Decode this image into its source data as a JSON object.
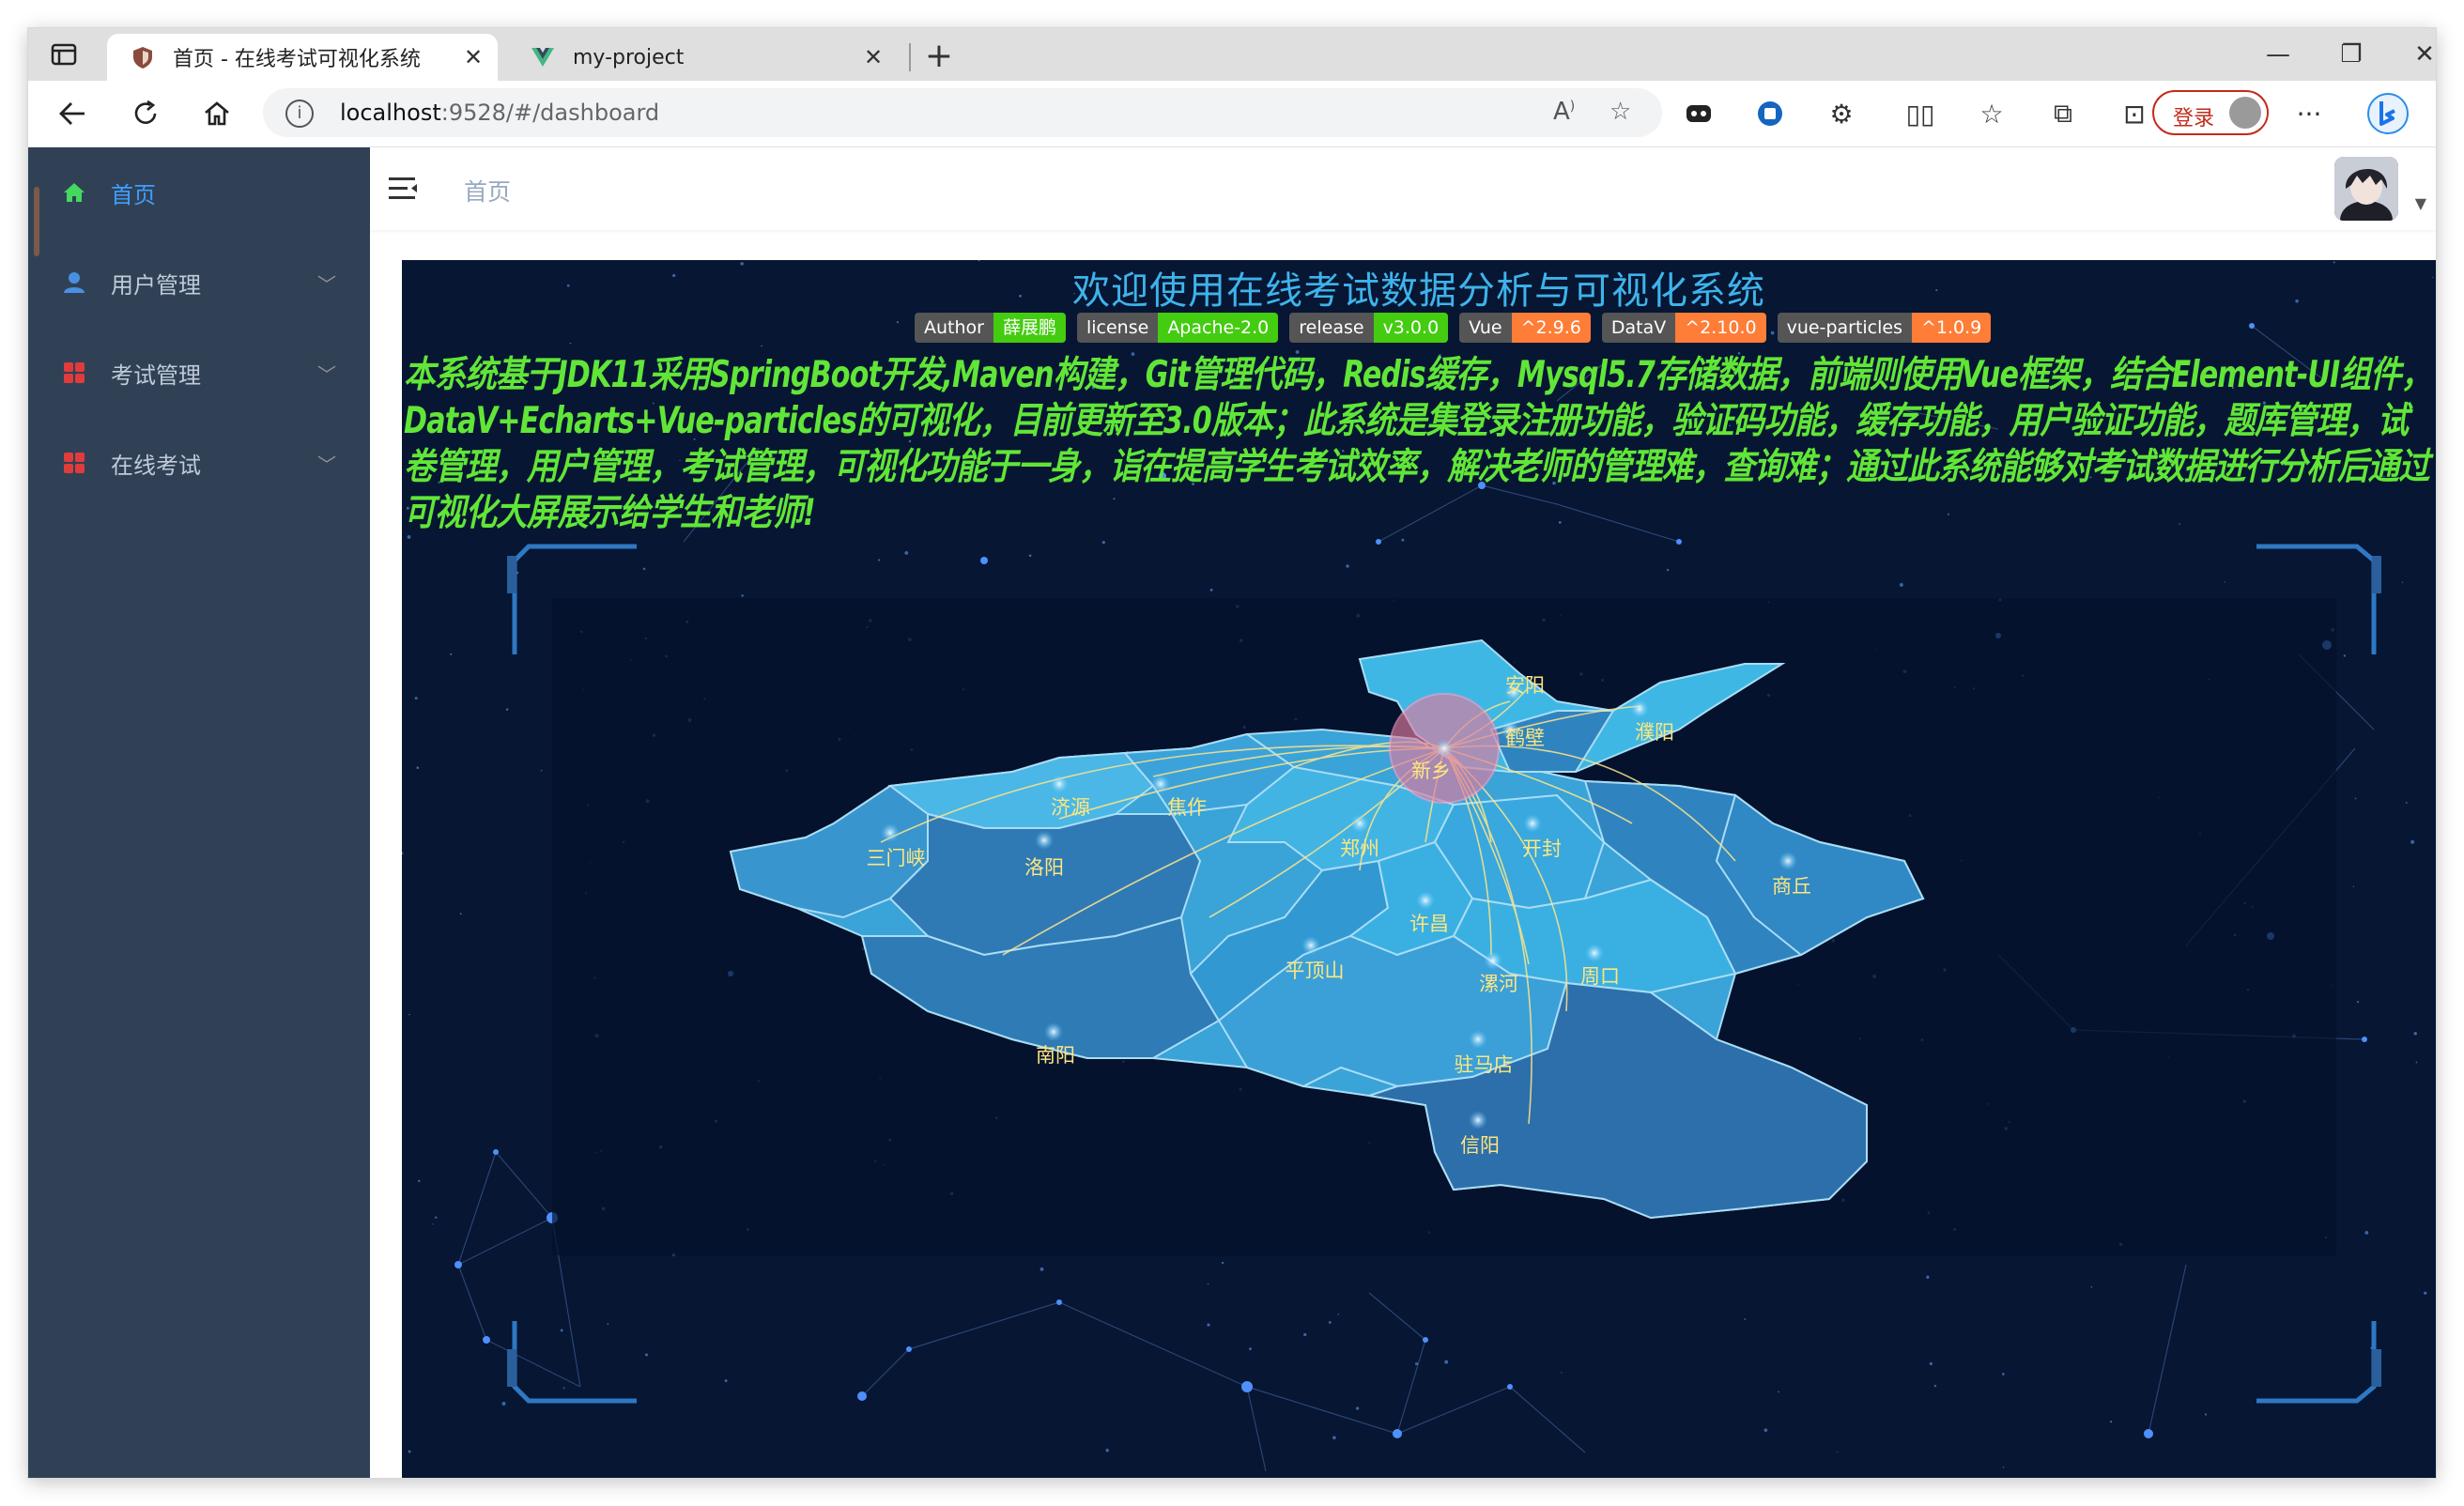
{
  "browser": {
    "tabs": [
      {
        "title": "首页 - 在线考试可视化系统",
        "active": true,
        "favicon": "shield-favicon-icon"
      },
      {
        "title": "my-project",
        "active": false,
        "favicon": "vue-favicon-icon"
      }
    ],
    "url_host": "localhost",
    "url_rest": ":9528/#/dashboard",
    "login_label": "登录"
  },
  "sidebar": {
    "items": [
      {
        "label": "首页",
        "icon": "home-icon",
        "active": true,
        "color": "#42d95e"
      },
      {
        "label": "用户管理",
        "icon": "user-icon",
        "active": false,
        "color": "#4a90e2"
      },
      {
        "label": "考试管理",
        "icon": "grid-icon",
        "active": false,
        "color": "#e23b3b"
      },
      {
        "label": "在线考试",
        "icon": "grid-icon",
        "active": false,
        "color": "#e23b3b"
      }
    ]
  },
  "navbar": {
    "breadcrumb": "首页"
  },
  "dashboard": {
    "title": "欢迎使用在线考试数据分析与可视化系统",
    "badges": [
      {
        "key": "Author",
        "value": "薛展鹏",
        "color": "green"
      },
      {
        "key": "license",
        "value": "Apache-2.0",
        "color": "green"
      },
      {
        "key": "release",
        "value": "v3.0.0",
        "color": "green"
      },
      {
        "key": "Vue",
        "value": "^2.9.6",
        "color": "orange"
      },
      {
        "key": "DataV",
        "value": "^2.10.0",
        "color": "orange"
      },
      {
        "key": "vue-particles",
        "value": "^1.0.9",
        "color": "orange"
      }
    ],
    "description": "本系统基于JDK11采用SpringBoot开发,Maven构建，Git管理代码，Redis缓存，Mysql5.7存储数据，前端则使用Vue框架，结合Element-UI组件，DataV+Echarts+Vue-particles的可视化，目前更新至3.0版本；此系统是集登录注册功能，验证码功能，缓存功能，用户验证功能，题库管理，试卷管理，用户管理，考试管理，可视化功能于一身，诣在提高学生考试效率，解决老师的管理难，查询难；通过此系统能够对考试数据进行分析后通过可视化大屏展示给学生和老师!",
    "map_cities": [
      {
        "name": "安阳"
      },
      {
        "name": "鹤壁"
      },
      {
        "name": "濮阳"
      },
      {
        "name": "新乡"
      },
      {
        "name": "济源"
      },
      {
        "name": "焦作"
      },
      {
        "name": "三门峡"
      },
      {
        "name": "洛阳"
      },
      {
        "name": "郑州"
      },
      {
        "name": "开封"
      },
      {
        "name": "商丘"
      },
      {
        "name": "许昌"
      },
      {
        "name": "平顶山"
      },
      {
        "name": "漯河"
      },
      {
        "name": "周口"
      },
      {
        "name": "南阳"
      },
      {
        "name": "驻马店"
      },
      {
        "name": "信阳"
      }
    ],
    "colors": {
      "title": "#3eb3ea",
      "description": "#61e637",
      "city_label": "#fde680",
      "background": "#061633"
    }
  }
}
